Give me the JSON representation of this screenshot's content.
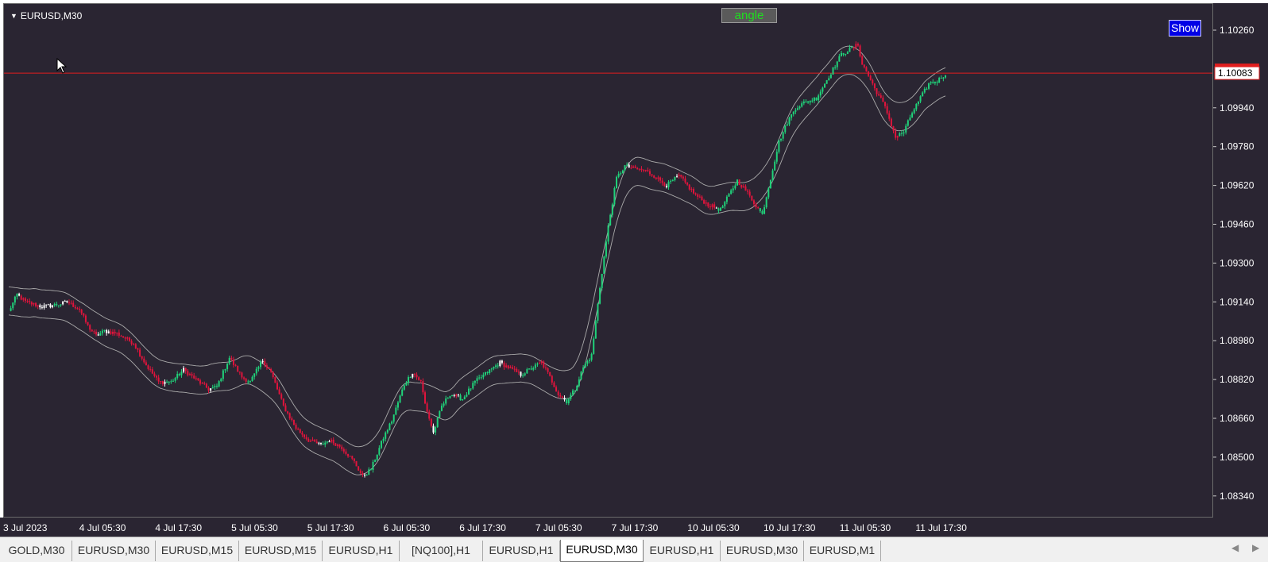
{
  "chart": {
    "symbol": "EURUSD,M30",
    "angle_button": "angle",
    "show_button": "Show",
    "current_price": "1.10083",
    "colors": {
      "bull": "#20d27a",
      "bear": "#e0143c",
      "neutral": "#ffffff",
      "background": "#2a2532",
      "price_line": "#e01e1e",
      "band": "#aaaaaa"
    }
  },
  "price_axis": {
    "labels": [
      "1.10260",
      "1.09940",
      "1.09780",
      "1.09620",
      "1.09460",
      "1.09300",
      "1.09140",
      "1.08980",
      "1.08820",
      "1.08660",
      "1.08500",
      "1.08340"
    ]
  },
  "time_axis": {
    "labels": [
      "3 Jul 2023",
      "4 Jul 05:30",
      "4 Jul 17:30",
      "5 Jul 05:30",
      "5 Jul 17:30",
      "6 Jul 05:30",
      "6 Jul 17:30",
      "7 Jul 05:30",
      "7 Jul 17:30",
      "10 Jul 05:30",
      "10 Jul 17:30",
      "11 Jul 05:30",
      "11 Jul 17:30"
    ]
  },
  "tabs": [
    {
      "label": "GOLD,M30"
    },
    {
      "label": "EURUSD,M30"
    },
    {
      "label": "EURUSD,M15"
    },
    {
      "label": "EURUSD,M15"
    },
    {
      "label": "EURUSD,H1"
    },
    {
      "label": "[NQ100],H1"
    },
    {
      "label": "EURUSD,H1"
    },
    {
      "label": "EURUSD,M30",
      "active": true
    },
    {
      "label": "EURUSD,H1"
    },
    {
      "label": "EURUSD,M30"
    },
    {
      "label": "EURUSD,M1"
    }
  ],
  "chart_data": {
    "type": "candlestick",
    "title": "EURUSD,M30",
    "ylim": [
      1.0829,
      1.1031
    ],
    "last_price": 1.10083,
    "path_anchors": [
      [
        0,
        1.091
      ],
      [
        4,
        1.0917
      ],
      [
        8,
        1.0914
      ],
      [
        16,
        1.0912
      ],
      [
        24,
        1.0913
      ],
      [
        28,
        1.0914
      ],
      [
        34,
        1.0911
      ],
      [
        38,
        1.0904
      ],
      [
        42,
        1.09
      ],
      [
        46,
        1.0902
      ],
      [
        52,
        1.0901
      ],
      [
        56,
        1.0899
      ],
      [
        60,
        1.0897
      ],
      [
        66,
        1.0888
      ],
      [
        72,
        1.0881
      ],
      [
        78,
        1.0881
      ],
      [
        84,
        1.0886
      ],
      [
        90,
        1.0882
      ],
      [
        96,
        1.0878
      ],
      [
        100,
        1.0879
      ],
      [
        106,
        1.0891
      ],
      [
        112,
        1.0883
      ],
      [
        116,
        1.0881
      ],
      [
        122,
        1.089
      ],
      [
        126,
        1.0885
      ],
      [
        132,
        1.0871
      ],
      [
        138,
        1.0862
      ],
      [
        144,
        1.0857
      ],
      [
        150,
        1.0855
      ],
      [
        154,
        1.0857
      ],
      [
        160,
        1.0854
      ],
      [
        166,
        1.0848
      ],
      [
        170,
        1.0842
      ],
      [
        174,
        1.0845
      ],
      [
        180,
        1.0858
      ],
      [
        184,
        1.0865
      ],
      [
        190,
        1.088
      ],
      [
        194,
        1.0885
      ],
      [
        198,
        1.0881
      ],
      [
        200,
        1.0872
      ],
      [
        204,
        1.086
      ],
      [
        208,
        1.0871
      ],
      [
        212,
        1.0876
      ],
      [
        218,
        1.0874
      ],
      [
        224,
        1.0881
      ],
      [
        230,
        1.0885
      ],
      [
        236,
        1.0889
      ],
      [
        240,
        1.0887
      ],
      [
        246,
        1.0884
      ],
      [
        252,
        1.0887
      ],
      [
        256,
        1.0889
      ],
      [
        260,
        1.0883
      ],
      [
        264,
        1.0876
      ],
      [
        268,
        1.0873
      ],
      [
        272,
        1.0878
      ],
      [
        276,
        1.0887
      ],
      [
        280,
        1.0892
      ],
      [
        284,
        1.092
      ],
      [
        288,
        1.0945
      ],
      [
        292,
        1.0965
      ],
      [
        296,
        1.097
      ],
      [
        300,
        1.0969
      ],
      [
        306,
        1.0968
      ],
      [
        310,
        1.0966
      ],
      [
        316,
        1.0962
      ],
      [
        322,
        1.0966
      ],
      [
        326,
        1.0962
      ],
      [
        330,
        1.0958
      ],
      [
        336,
        1.0954
      ],
      [
        342,
        1.0952
      ],
      [
        346,
        1.0958
      ],
      [
        350,
        1.0964
      ],
      [
        354,
        1.096
      ],
      [
        358,
        1.0955
      ],
      [
        362,
        1.095
      ],
      [
        366,
        1.0965
      ],
      [
        370,
        1.098
      ],
      [
        374,
        1.0988
      ],
      [
        378,
        1.0994
      ],
      [
        382,
        1.0996
      ],
      [
        388,
        1.0998
      ],
      [
        392,
        1.1004
      ],
      [
        396,
        1.101
      ],
      [
        400,
        1.1016
      ],
      [
        404,
        1.1018
      ],
      [
        408,
        1.102
      ],
      [
        410,
        1.1012
      ],
      [
        412,
        1.1009
      ],
      [
        416,
        1.1002
      ],
      [
        420,
        1.0996
      ],
      [
        422,
        1.0992
      ],
      [
        426,
        1.0982
      ],
      [
        430,
        1.0984
      ],
      [
        434,
        1.0992
      ],
      [
        438,
        1.0998
      ],
      [
        442,
        1.1004
      ],
      [
        446,
        1.1005
      ],
      [
        450,
        1.1008
      ]
    ]
  }
}
